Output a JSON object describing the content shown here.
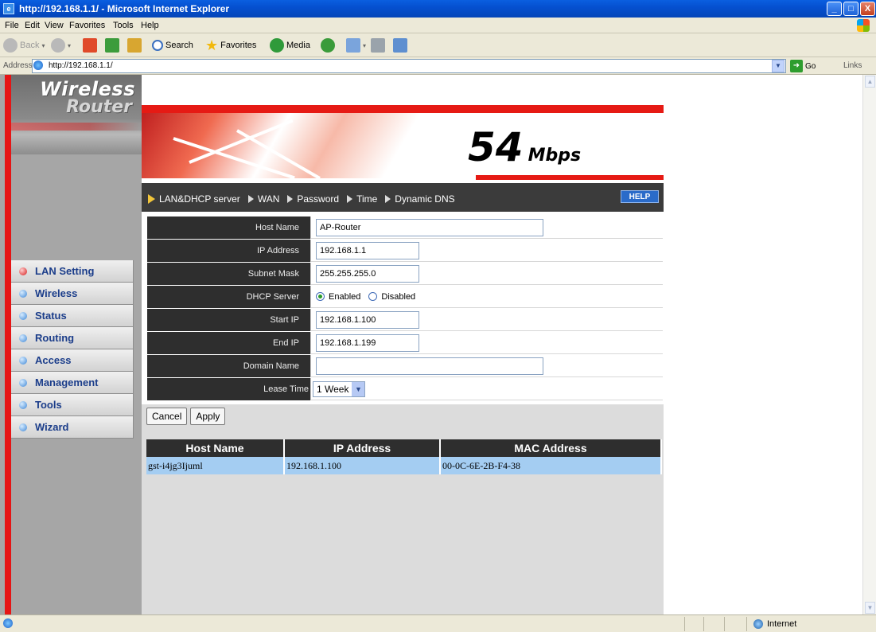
{
  "window": {
    "title": "http://192.168.1.1/ - Microsoft Internet Explorer",
    "minimize": "_",
    "maximize": "□",
    "close": "X"
  },
  "menu": [
    "File",
    "Edit",
    "View",
    "Favorites",
    "Tools",
    "Help"
  ],
  "toolbar": {
    "back": "Back",
    "search": "Search",
    "favorites": "Favorites",
    "media": "Media"
  },
  "address": {
    "label": "Address",
    "url": "http://192.168.1.1/",
    "go": "Go",
    "links": "Links"
  },
  "logo": {
    "line1": "Wireless",
    "line2": "Router"
  },
  "banner": {
    "speed": "54",
    "unit": "Mbps"
  },
  "tabs": [
    "LAN&DHCP server",
    "WAN",
    "Password",
    "Time",
    "Dynamic DNS"
  ],
  "help_label": "HELP",
  "sidebar": {
    "items": [
      {
        "label": "LAN Setting",
        "active": true
      },
      {
        "label": "Wireless"
      },
      {
        "label": "Status"
      },
      {
        "label": "Routing"
      },
      {
        "label": "Access"
      },
      {
        "label": "Management"
      },
      {
        "label": "Tools"
      },
      {
        "label": "Wizard"
      }
    ]
  },
  "form": {
    "host_name": {
      "label": "Host Name",
      "value": "AP-Router"
    },
    "ip_address": {
      "label": "IP Address",
      "value": "192.168.1.1"
    },
    "subnet_mask": {
      "label": "Subnet Mask",
      "value": "255.255.255.0"
    },
    "dhcp_server": {
      "label": "DHCP Server",
      "enabled": "Enabled",
      "disabled": "Disabled",
      "selected": "Enabled"
    },
    "start_ip": {
      "label": "Start IP",
      "value": "192.168.1.100"
    },
    "end_ip": {
      "label": "End IP",
      "value": "192.168.1.199"
    },
    "domain_name": {
      "label": "Domain Name",
      "value": ""
    },
    "lease_time": {
      "label": "Lease Time",
      "value": "1 Week"
    }
  },
  "buttons": {
    "cancel": "Cancel",
    "apply": "Apply"
  },
  "table": {
    "headers": [
      "Host Name",
      "IP Address",
      "MAC Address"
    ],
    "rows": [
      [
        "gst-i4jg3Ijuml",
        "192.168.1.100",
        "00-0C-6E-2B-F4-38"
      ]
    ]
  },
  "status": {
    "zone": "Internet"
  }
}
